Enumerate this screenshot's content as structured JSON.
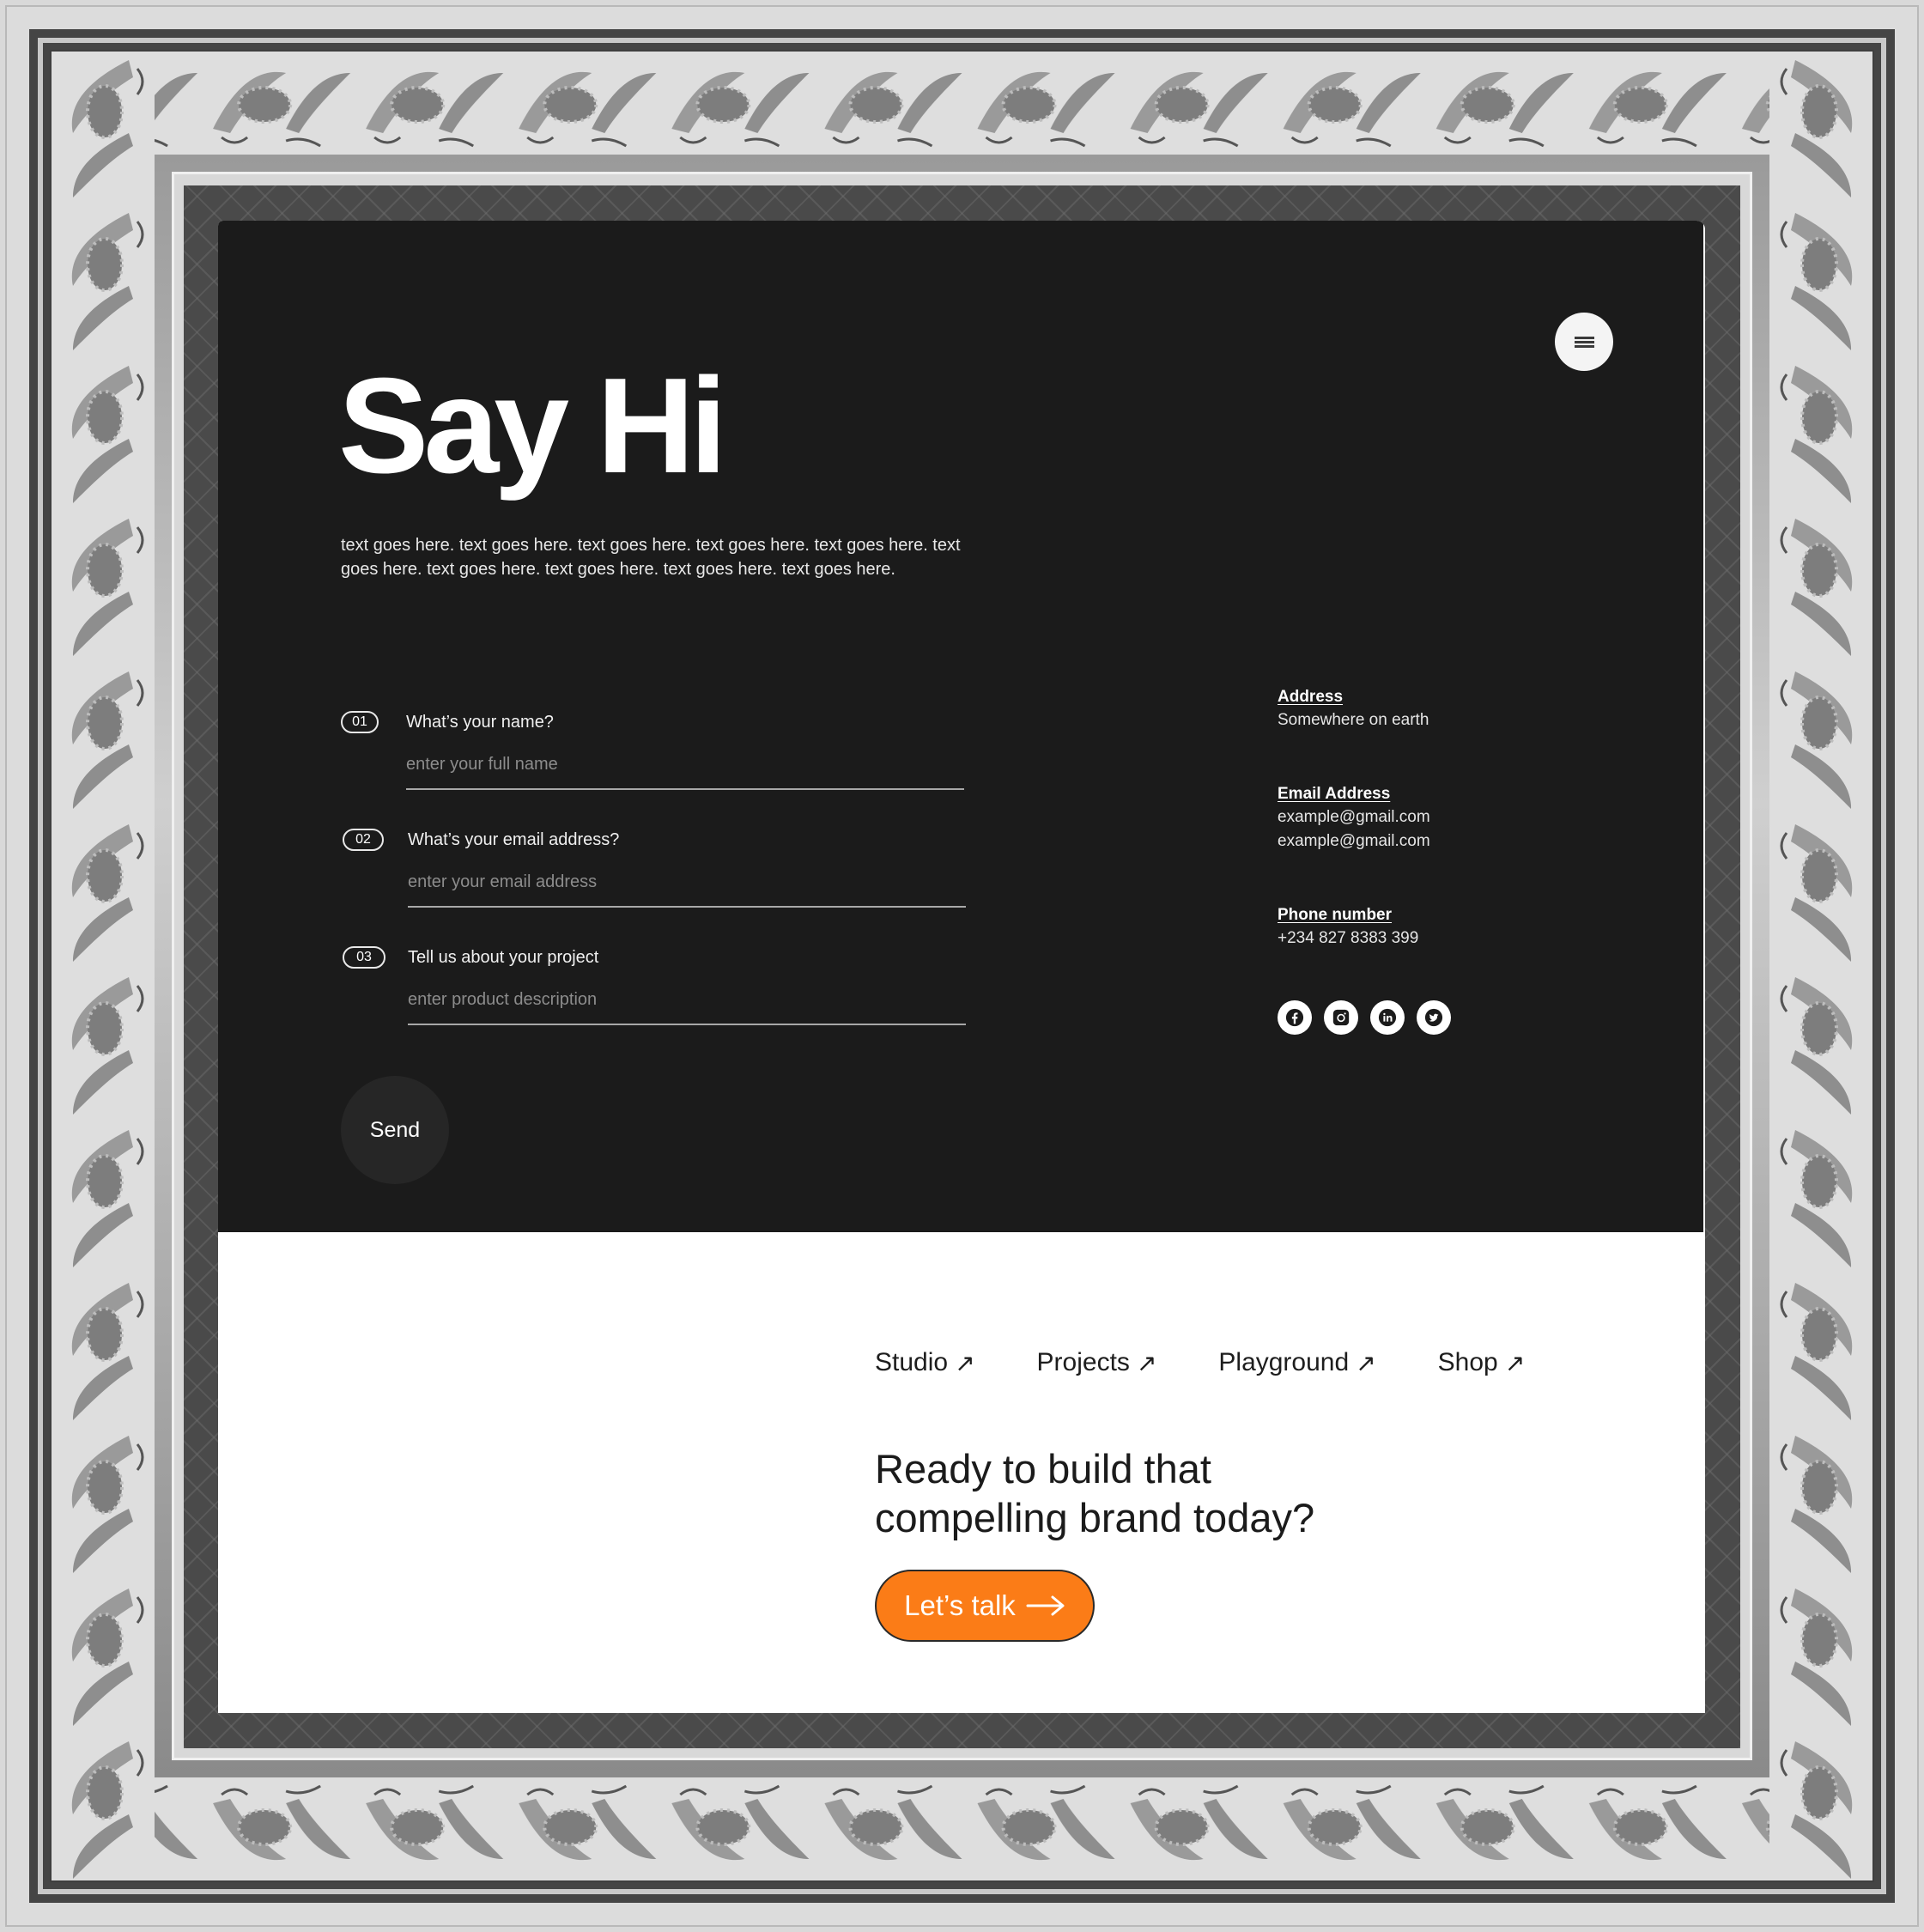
{
  "header": {
    "menu_icon": "hamburger-menu-icon"
  },
  "hero": {
    "title": "Say Hi",
    "text": "text goes here. text goes here. text goes here. text goes here. text goes here. text goes here. text goes here. text goes here. text goes here. text goes here."
  },
  "form": {
    "fields": [
      {
        "number": "01",
        "label": "What’s your name?",
        "placeholder": "enter your full name",
        "value": ""
      },
      {
        "number": "02",
        "label": "What’s your email address?",
        "placeholder": "enter your email address",
        "value": ""
      },
      {
        "number": "03",
        "label": "Tell us about your project",
        "placeholder": "enter product description",
        "value": ""
      }
    ],
    "send_label": "Send"
  },
  "contact": {
    "address": {
      "label": "Address",
      "value": "Somewhere on earth"
    },
    "email": {
      "label": "Email Address",
      "values": [
        "example@gmail.com",
        "example@gmail.com"
      ]
    },
    "phone": {
      "label": "Phone number",
      "value": "+234 827 8383 399"
    },
    "socials": [
      {
        "name": "facebook",
        "icon": "facebook-icon"
      },
      {
        "name": "instagram",
        "icon": "instagram-icon"
      },
      {
        "name": "linkedin",
        "icon": "linkedin-icon"
      },
      {
        "name": "twitter",
        "icon": "twitter-icon"
      }
    ]
  },
  "footer": {
    "nav": [
      {
        "label": "Studio",
        "arrow": "↗"
      },
      {
        "label": "Projects",
        "arrow": "↗"
      },
      {
        "label": "Playground",
        "arrow": "↗"
      },
      {
        "label": "Shop",
        "arrow": "↗"
      }
    ],
    "cta_line1": "Ready to build that",
    "cta_line2": "compelling brand today?",
    "cta_button": "Let’s talk"
  },
  "colors": {
    "dark_bg": "#1b1b1b",
    "accent_orange": "#fb7c17",
    "white": "#ffffff"
  }
}
